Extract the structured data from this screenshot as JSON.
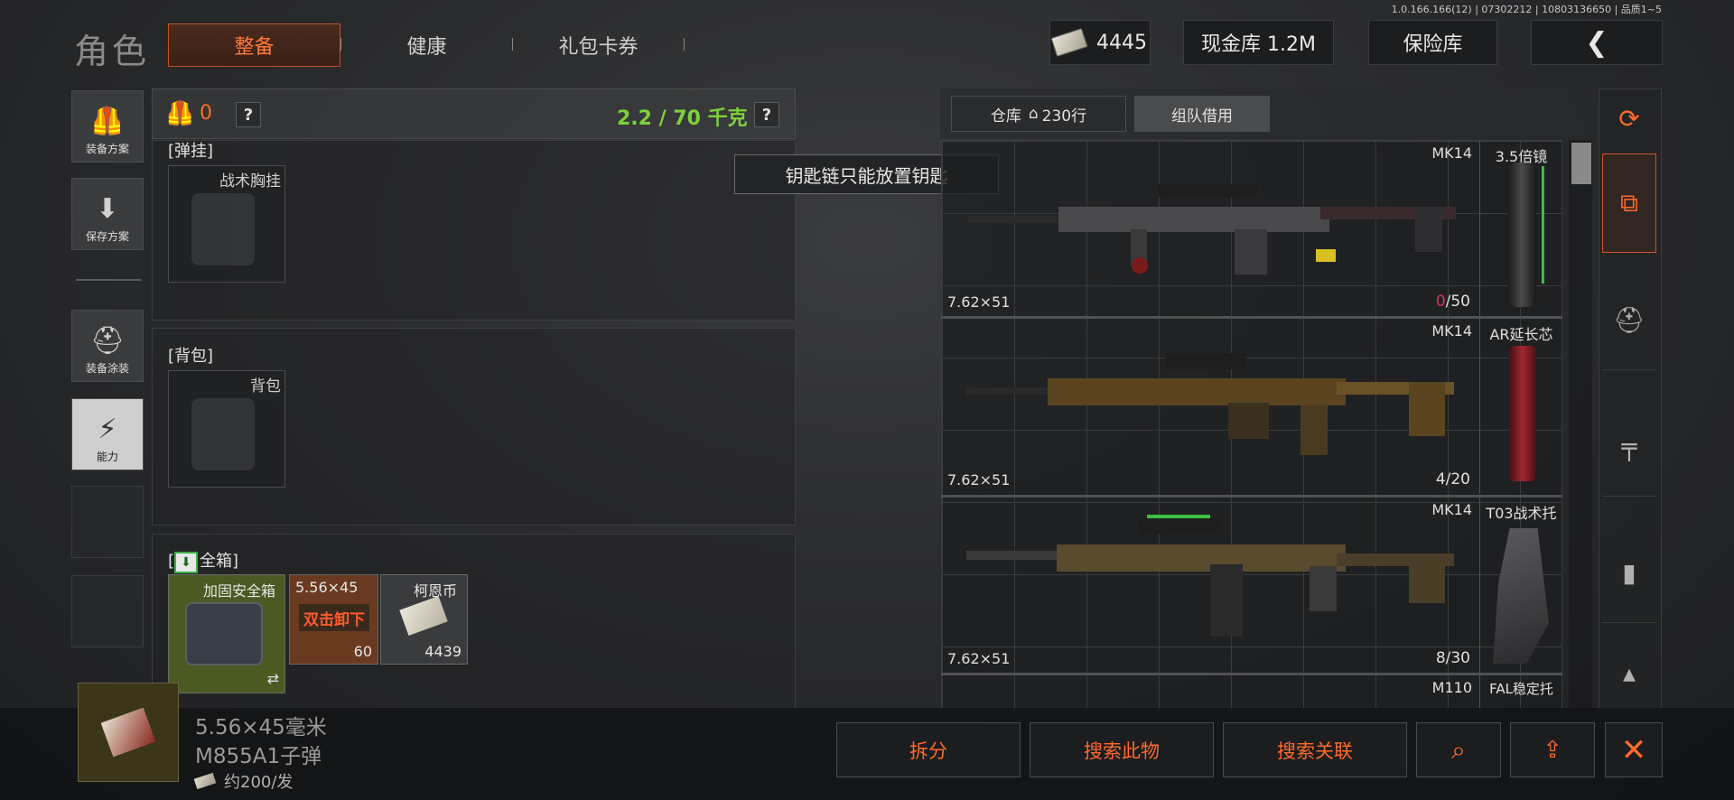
{
  "version": "1.0.166.166(12) | 07302212 | 10803136650 | 品质1~5",
  "header": {
    "title": "角色",
    "tabs": [
      "整备",
      "健康",
      "礼包卡券"
    ],
    "currency": "4445",
    "cash_vault": "现金库 1.2M",
    "insurance": "保险库"
  },
  "sidebar": {
    "items": [
      {
        "label": "装备方案",
        "icon": "vest-icon"
      },
      {
        "label": "保存方案",
        "icon": "download-icon"
      },
      {
        "label": "装备涂装",
        "icon": "helmet-icon"
      },
      {
        "label": "能力",
        "icon": "ability-icon"
      }
    ]
  },
  "equip": {
    "armor_count": "0",
    "weight": "2.2 / 70 千克",
    "help": "?",
    "rig_section": "弹挂",
    "rig_slot": "战术胸挂",
    "backpack_section": "背包",
    "backpack_slot": "背包",
    "safe_section": "全箱",
    "safe_items": [
      {
        "name": "加固安全箱",
        "value": ""
      },
      {
        "name": "5.56×45",
        "value": "60",
        "overlay": "双击卸下"
      },
      {
        "name": "柯恩币",
        "value": "4439"
      }
    ]
  },
  "tooltip": "钥匙链只能放置钥匙",
  "warehouse": {
    "tab_label": "仓库",
    "tab_rows": "230行",
    "tab_team": "组队借用",
    "rows": [
      {
        "gun": "MK14",
        "caliber": "7.62×51",
        "ammo_cur": "0",
        "ammo_max": "/50",
        "attachment": "3.5倍镜"
      },
      {
        "gun": "MK14",
        "caliber": "7.62×51",
        "ammo_cur": "4",
        "ammo_max": "/20",
        "attachment": "AR延长芯"
      },
      {
        "gun": "MK14",
        "caliber": "7.62×51",
        "ammo_cur": "8",
        "ammo_max": "/30",
        "attachment": "T03战术托"
      },
      {
        "gun": "M110",
        "caliber": "",
        "ammo_cur": "",
        "ammo_max": "",
        "attachment": "FAL稳定托"
      }
    ]
  },
  "selected": {
    "name_line1": "5.56×45毫米",
    "name_line2": "M855A1子弹",
    "price": "约200/发"
  },
  "actions": {
    "split": "拆分",
    "search_item": "搜索此物",
    "search_related": "搜索关联"
  },
  "colors": {
    "accent": "#ff6a2a",
    "weight_green": "#7fd13a",
    "ammo_red": "#e0305a"
  }
}
